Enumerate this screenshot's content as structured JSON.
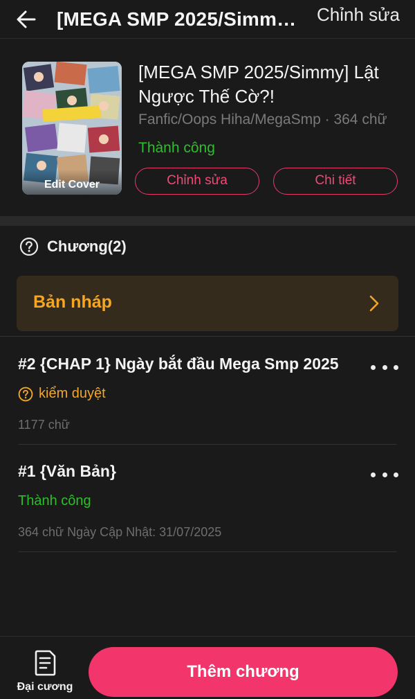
{
  "header": {
    "title": "[MEGA SMP 2025/Simmy] Lật Ngược Thế Cờ?!",
    "edit_label": "Chỉnh sửa",
    "icons": {
      "back": "arrow-left-icon"
    }
  },
  "story": {
    "cover_label": "Edit Cover",
    "title": "[MEGA SMP 2025/Simmy] Lật Ngược Thế Cờ?!",
    "meta": "Fanfic/Oops Hiha/MegaSmp · 364 chữ",
    "status": "Thành công",
    "edit_button": "Chỉnh sửa",
    "detail_button": "Chi tiết"
  },
  "chapters": {
    "heading": "Chương(2)",
    "draft_label": "Bản nháp",
    "items": [
      {
        "title": "#2 {CHAP 1} Ngày bắt đầu Mega Smp 2025",
        "status": "kiểm duyệt",
        "meta": "1177 chữ"
      },
      {
        "title": "#1 {Văn Bản}",
        "status": "Thành công",
        "meta": "364 chữ Ngày Cập Nhật: 31/07/2025"
      }
    ]
  },
  "bottom": {
    "outline_label": "Đại cương",
    "add_chapter_label": "Thêm chương"
  },
  "colors": {
    "background": "#1a1a1a",
    "accent": "#f2356a",
    "success": "#2bc02b",
    "warning": "#f5a623",
    "draft_bg": "#342b1c"
  }
}
